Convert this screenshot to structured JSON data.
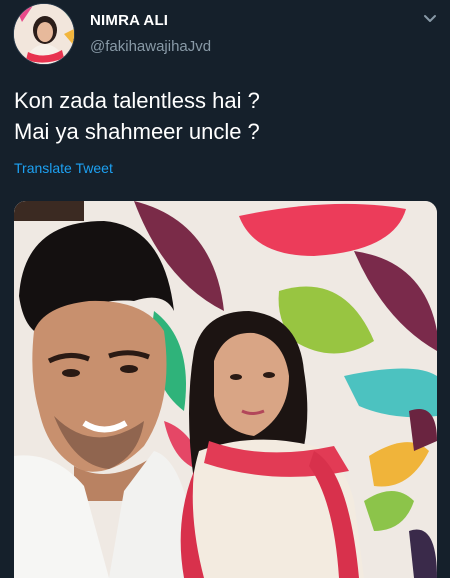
{
  "user": {
    "display_name": "NIMRA ALI",
    "handle": "@fakihawajihaJvd"
  },
  "tweet": {
    "lines": [
      "Kon zada talentless hai ?",
      "Mai ya shahmeer uncle ?"
    ],
    "translate_label": "Translate Tweet"
  },
  "icons": {
    "menu": "chevron-down-icon"
  },
  "colors": {
    "background": "#15202b",
    "text": "#ffffff",
    "secondary": "#8899a6",
    "accent": "#1da1f2"
  }
}
